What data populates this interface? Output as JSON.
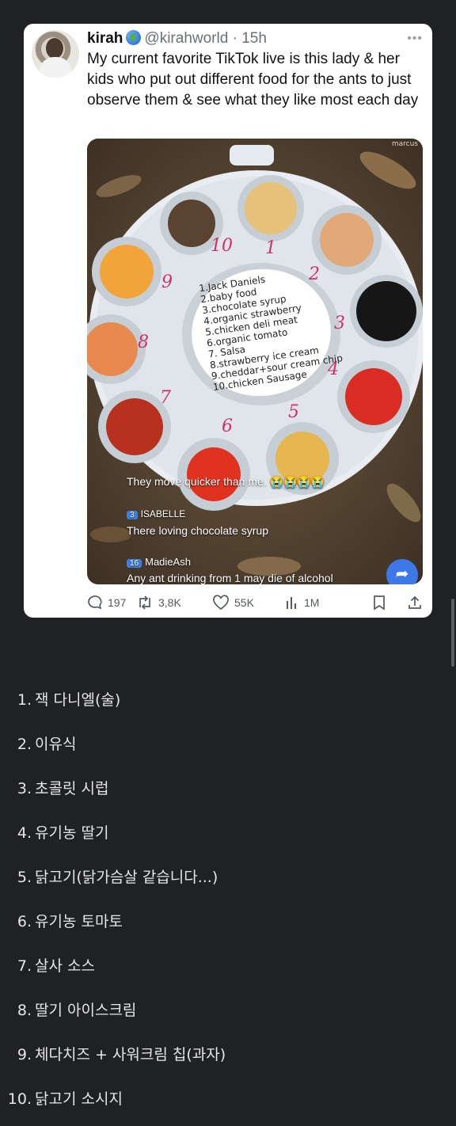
{
  "tweet": {
    "name": "kirah",
    "handle": "@kirahworld",
    "separator": " · ",
    "time": "15h",
    "more": "•••",
    "text": "My current favorite TikTok live is this lady & her kids who put out different food for the ants to just observe them & see what they like most each day",
    "media": {
      "watermark": "marcus",
      "plate_numbers": [
        "1",
        "2",
        "3",
        "4",
        "5",
        "6",
        "7",
        "8",
        "9",
        "10"
      ],
      "note_lines": [
        "1.Jack Daniels",
        "2.baby food",
        "3.chocolate syrup",
        "4.organic strawberry",
        "5.chicken deli meat",
        "6.organic tomato",
        "7. Salsa",
        "8.strawberry ice cream",
        "9.cheddar+sour cream chip",
        "10.chicken Sausage"
      ],
      "comments": [
        {
          "badge": "",
          "user": "",
          "text": "They move quicker than me. 😭😭😭😭"
        },
        {
          "badge": "3",
          "user": "ISABELLE",
          "text": "There loving chocolate syrup"
        },
        {
          "badge": "16",
          "user": "MadieAsh",
          "text": "Any ant drinking from 1 may die of alcohol"
        }
      ]
    },
    "actions": {
      "replies": "197",
      "retweets": "3,8K",
      "likes": "55K",
      "views": "1M"
    }
  },
  "list": [
    {
      "num": "1.",
      "text": "잭 다니엘(술)"
    },
    {
      "num": "2.",
      "text": "이유식"
    },
    {
      "num": "3.",
      "text": "초콜릿 시럽"
    },
    {
      "num": "4.",
      "text": "유기농 딸기"
    },
    {
      "num": "5.",
      "text": "닭고기(닭가슴살 같습니다...)"
    },
    {
      "num": "6.",
      "text": "유기농 토마토"
    },
    {
      "num": "7.",
      "text": "살사 소스"
    },
    {
      "num": "8.",
      "text": "딸기 아이스크림"
    },
    {
      "num": "9.",
      "text": "체다치즈 + 사워크림 칩(과자)"
    },
    {
      "num": "10.",
      "text": "닭고기 소시지"
    }
  ],
  "colors": {
    "page_background": "#1f2124",
    "card_background": "#ffffff",
    "accent_blue": "#3c78e8"
  }
}
